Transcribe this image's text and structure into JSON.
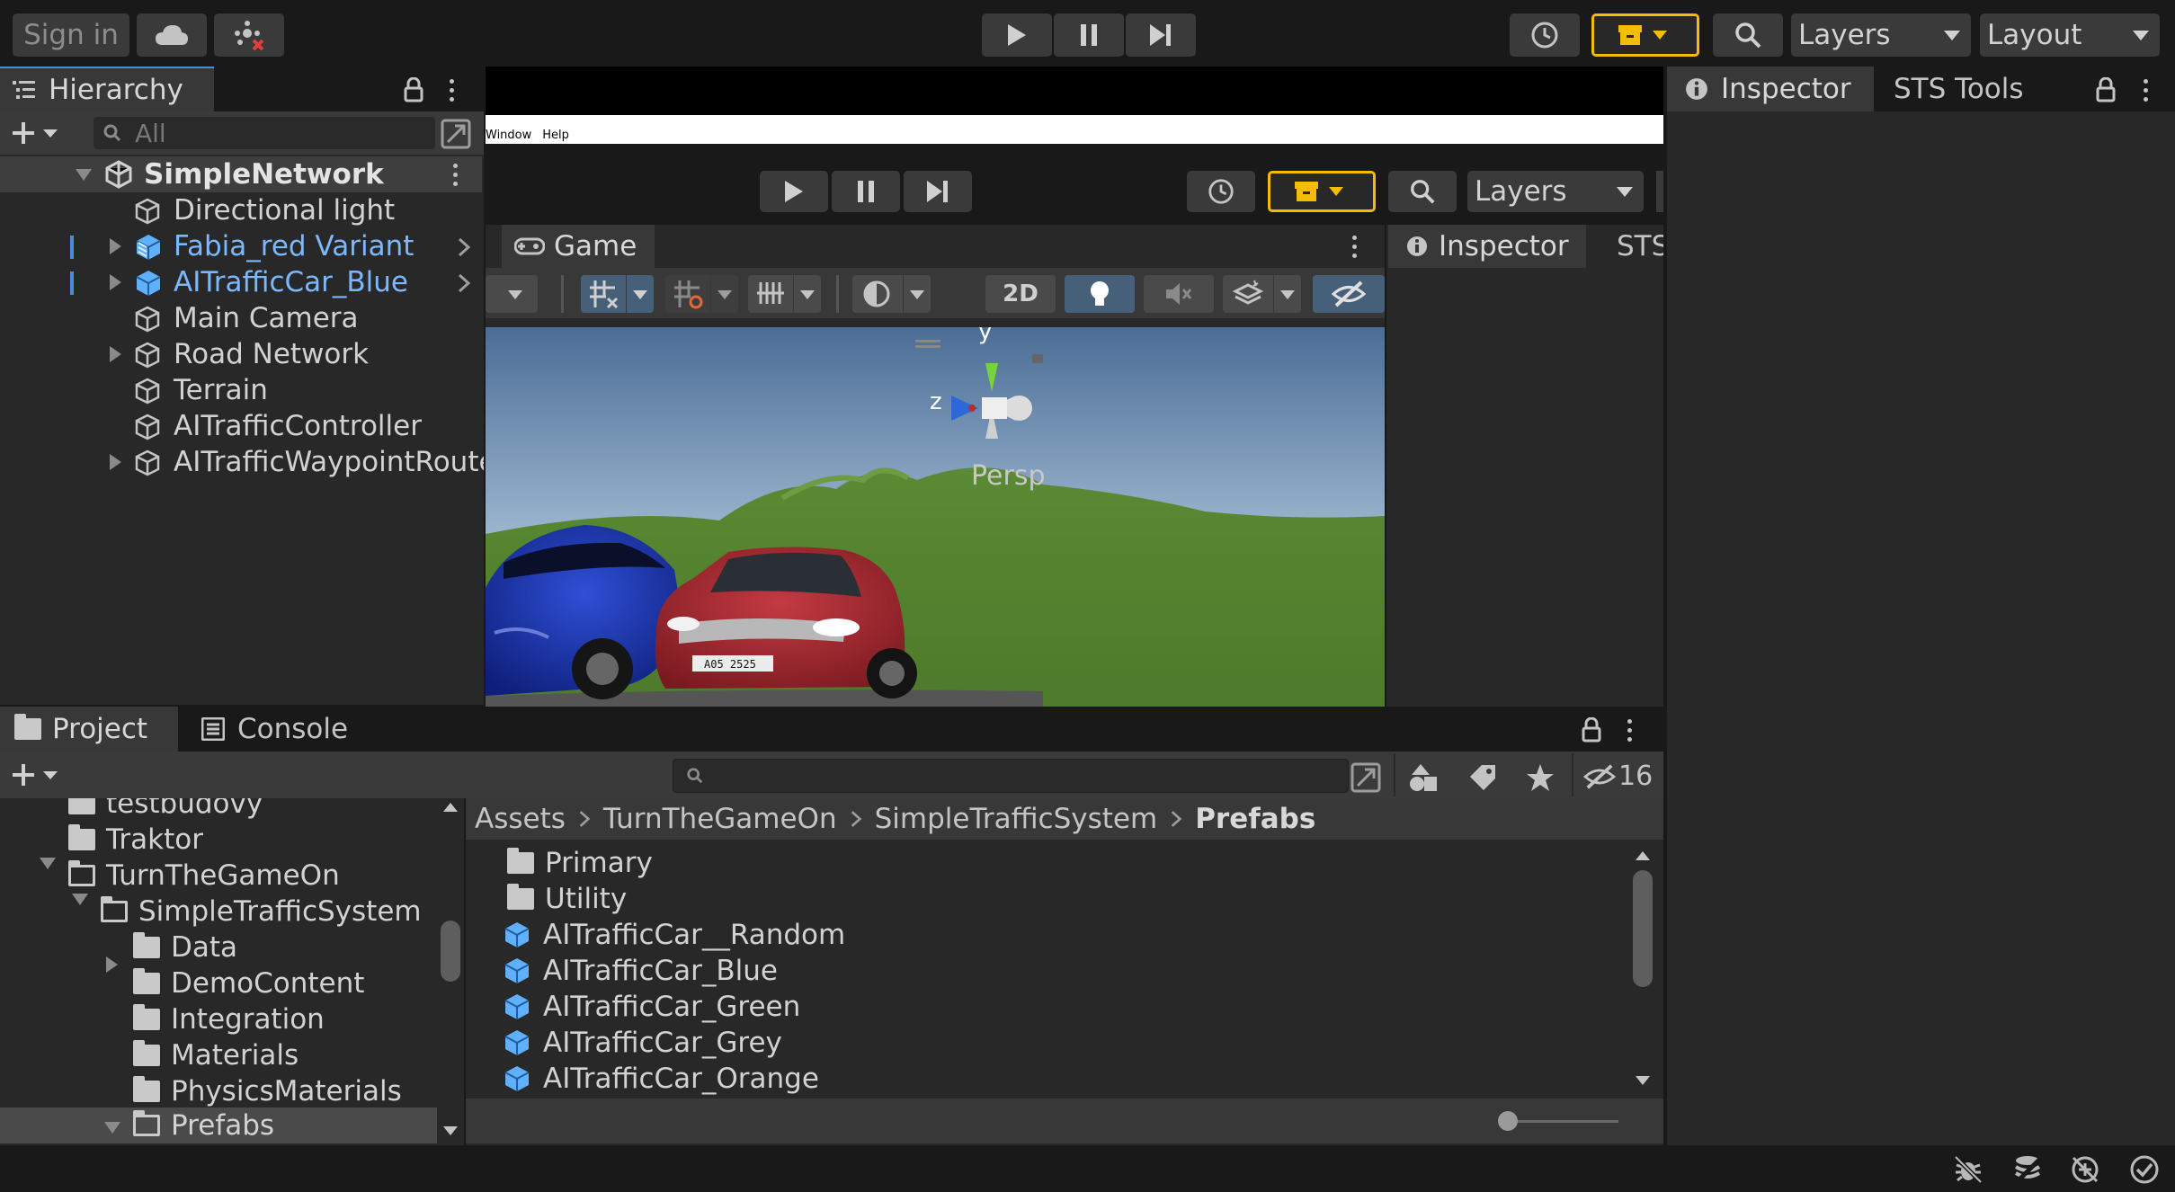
{
  "toolbar": {
    "sign_in": "Sign in",
    "layers": "Layers",
    "layout": "Layout",
    "icons": [
      "cloud-icon",
      "collab-icon",
      "play-icon",
      "pause-icon",
      "step-icon",
      "history-icon",
      "package-icon",
      "search-icon"
    ]
  },
  "hierarchy": {
    "tab": "Hierarchy",
    "search_placeholder": "All",
    "scene": "SimpleNetwork",
    "items": [
      {
        "label": "Directional light"
      },
      {
        "label": "Fabia_red Variant"
      },
      {
        "label": "AITrafficCar_Blue"
      },
      {
        "label": "Main Camera"
      },
      {
        "label": "Road Network"
      },
      {
        "label": "Terrain"
      },
      {
        "label": "AITrafficController"
      },
      {
        "label": "AITrafficWaypointRoute"
      }
    ]
  },
  "embedded": {
    "menu": [
      "Window",
      "Help"
    ],
    "layers": "Layers",
    "game_tab": "Game",
    "inspector_tab": "Inspector",
    "sts_tab": "STS",
    "btn_2d": "2D",
    "gizmo_y": "y",
    "gizmo_z": "z",
    "persp": "Persp",
    "plate": "A05 2525"
  },
  "inspector": {
    "tab": "Inspector",
    "sts_tab": "STS Tools"
  },
  "project": {
    "tab_project": "Project",
    "tab_console": "Console",
    "hidden_count": "16",
    "tree": [
      {
        "label": "testbudovy"
      },
      {
        "label": "Traktor"
      },
      {
        "label": "TurnTheGameOn"
      },
      {
        "label": "SimpleTrafficSystem"
      },
      {
        "label": "Data"
      },
      {
        "label": "DemoContent"
      },
      {
        "label": "Integration"
      },
      {
        "label": "Materials"
      },
      {
        "label": "PhysicsMaterials"
      },
      {
        "label": "Prefabs"
      }
    ],
    "breadcrumb": [
      "Assets",
      "TurnTheGameOn",
      "SimpleTrafficSystem",
      "Prefabs"
    ],
    "assets": [
      {
        "label": "Primary"
      },
      {
        "label": "Utility"
      },
      {
        "label": "AITrafficCar__Random"
      },
      {
        "label": "AITrafficCar_Blue"
      },
      {
        "label": "AITrafficCar_Green"
      },
      {
        "label": "AITrafficCar_Grey"
      },
      {
        "label": "AITrafficCar_Orange"
      }
    ]
  },
  "colors": {
    "accent_gold": "#f4bc02",
    "selection_blue": "#2c5d87",
    "prefab_blue": "#7bb8ff"
  }
}
